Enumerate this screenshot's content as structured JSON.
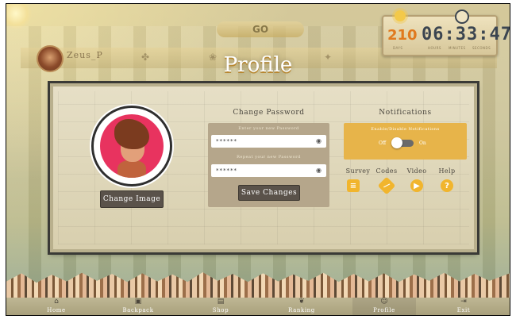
{
  "header": {
    "player_name": "Zeus_P",
    "logo_text": "GO",
    "page_title": "Profile",
    "timer": {
      "days": "210",
      "time": "06:33:47",
      "days_label": "DAYS",
      "hours_label": "HOURS",
      "minutes_label": "MINUTES",
      "seconds_label": "SECONDS"
    }
  },
  "avatar": {
    "change_image_label": "Change Image"
  },
  "password": {
    "title": "Change Password",
    "new_label": "Enter your new Password",
    "new_value": "******",
    "repeat_label": "Repeat your new Password",
    "repeat_value": "******",
    "save_label": "Save Changes"
  },
  "notifications": {
    "title": "Notifications",
    "toggle_label": "Enable/Disable Notifications",
    "off_label": "Off",
    "on_label": "On",
    "enabled": false
  },
  "quick_links": [
    {
      "label": "Survey",
      "icon": "survey-icon"
    },
    {
      "label": "Codes",
      "icon": "codes-icon"
    },
    {
      "label": "Video",
      "icon": "video-icon"
    },
    {
      "label": "Help",
      "icon": "help-icon"
    }
  ],
  "nav": [
    {
      "label": "Home",
      "icon": "home-icon"
    },
    {
      "label": "Backpack",
      "icon": "backpack-icon"
    },
    {
      "label": "Shop",
      "icon": "shop-icon"
    },
    {
      "label": "Ranking",
      "icon": "ranking-icon"
    },
    {
      "label": "Profile",
      "icon": "profile-icon",
      "active": true
    },
    {
      "label": "Exit",
      "icon": "exit-icon"
    }
  ],
  "colors": {
    "accent": "#e7b44a",
    "avatar_bg": "#e8335f",
    "timer_days": "#e07a1f",
    "panel": "#b5a68b"
  }
}
